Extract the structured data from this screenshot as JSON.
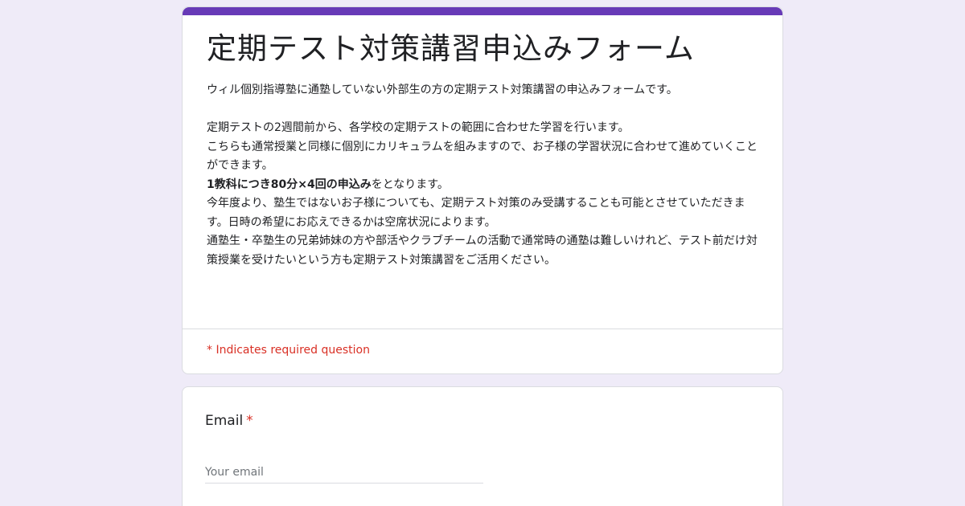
{
  "colors": {
    "background": "#efebf8",
    "accent": "#673ab7",
    "required": "#d93025"
  },
  "form": {
    "title": "定期テスト対策講習申込みフォーム",
    "description": {
      "line1": "ウィル個別指導塾に通塾していない外部生の方の定期テスト対策講習の申込みフォームです。",
      "line2": "定期テストの2週間前から、各学校の定期テストの範囲に合わせた学習を行います。",
      "line3": "こちらも通常授業と同様に個別にカリキュラムを組みますので、お子様の学習状況に合わせて進めていくことができます。",
      "line4_bold": "1教科につき80分×4回の申込み",
      "line4_rest": "をとなります。",
      "line5": "今年度より、塾生ではないお子様についても、定期テスト対策のみ受講することも可能とさせていただきます。日時の希望にお応えできるかは空席状況によります。",
      "line6": "通塾生・卒塾生の兄弟姉妹の方や部活やクラブチームの活動で通常時の通塾は難しいけれど、テスト前だけ対策授業を受けたいという方も定期テスト対策講習をご活用ください。"
    },
    "required_note": "* Indicates required question"
  },
  "questions": {
    "email": {
      "label": "Email",
      "required_mark": "*",
      "placeholder": "Your email",
      "value": ""
    }
  }
}
